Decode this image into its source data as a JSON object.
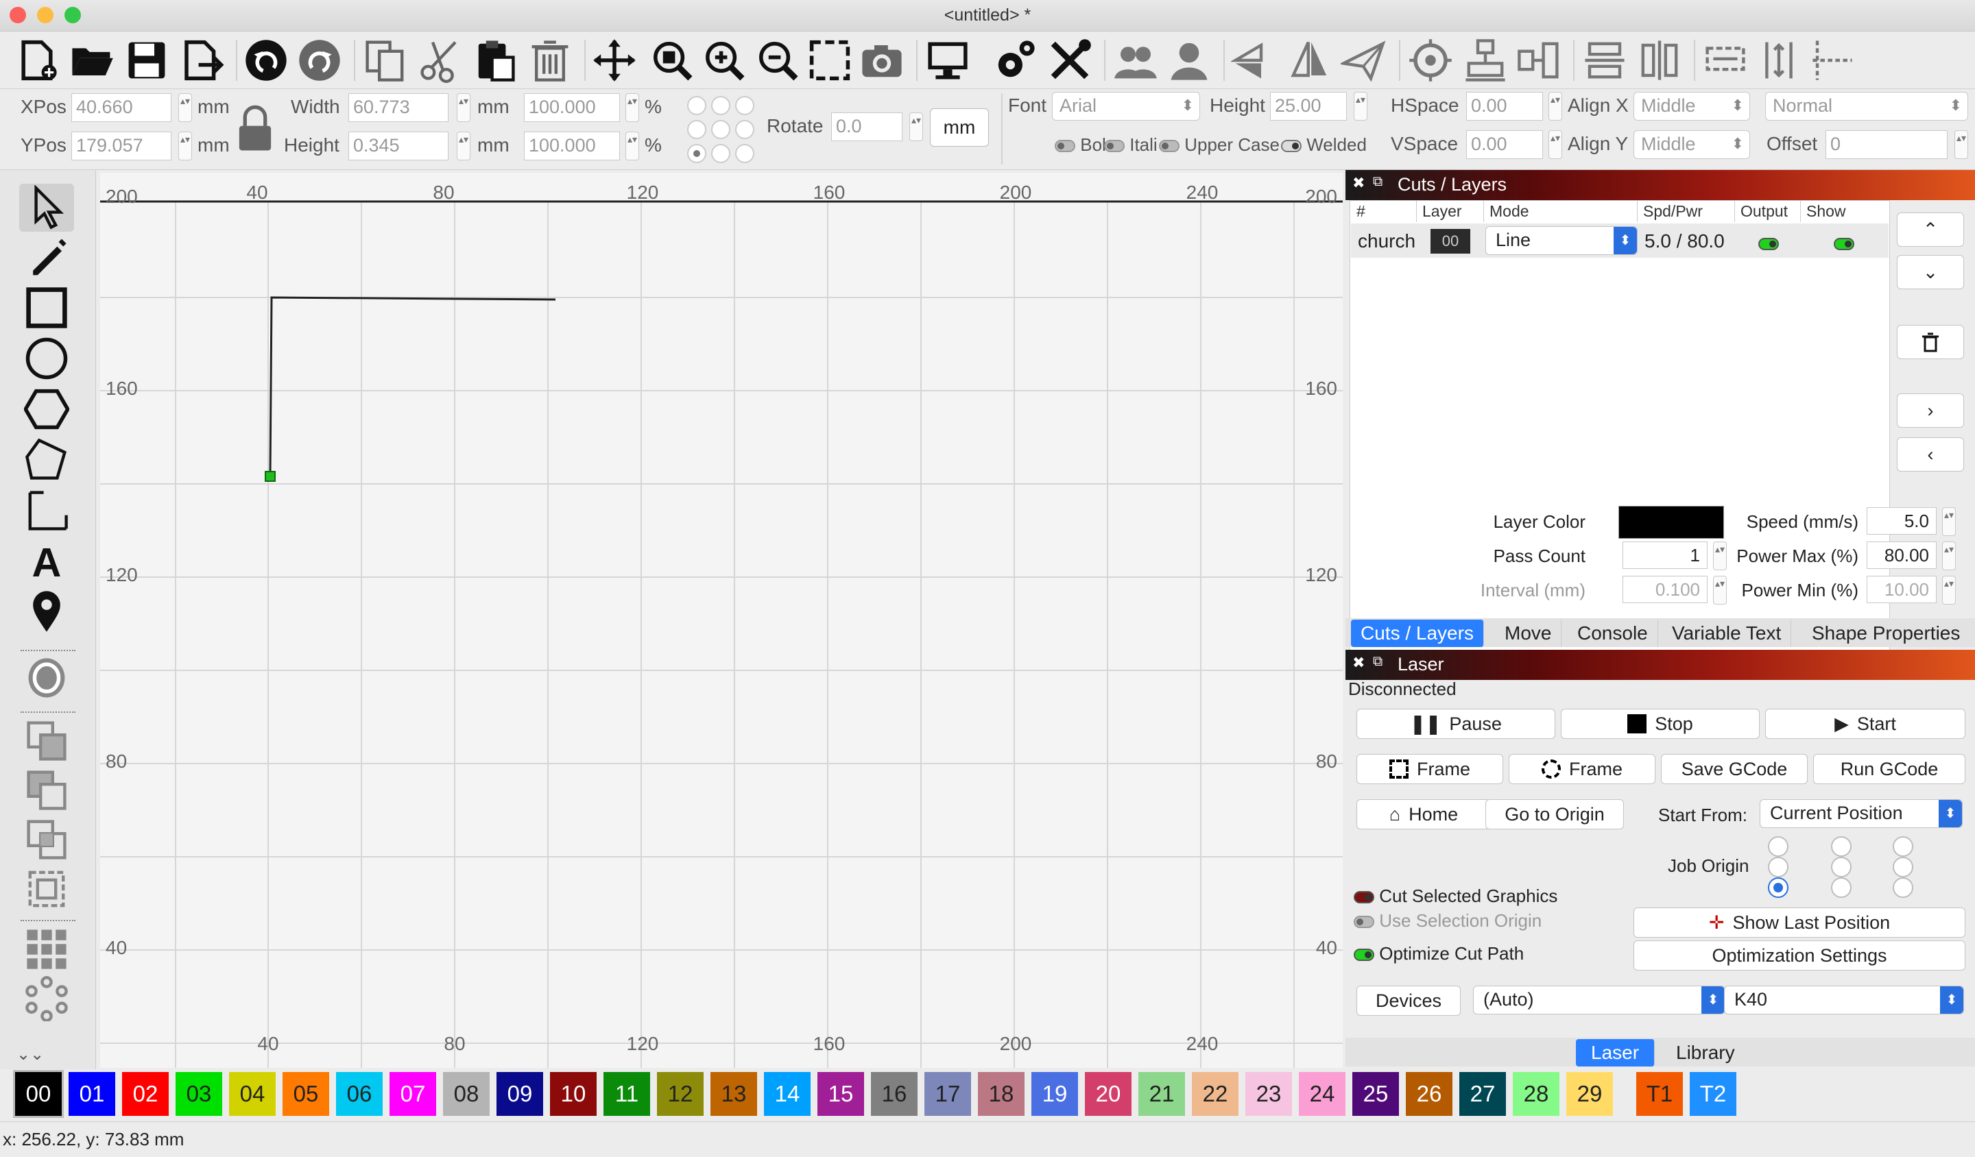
{
  "window": {
    "title": "<untitled> *"
  },
  "props": {
    "xpos_label": "XPos",
    "xpos_value": "40.660",
    "ypos_label": "YPos",
    "ypos_value": "179.057",
    "unit": "mm",
    "width_label": "Width",
    "width_value": "60.773",
    "height_label": "Height",
    "height_value": "0.345",
    "pct_w": "100.000",
    "pct_h": "100.000",
    "pct": "%",
    "rotate_label": "Rotate",
    "rotate_value": "0.0",
    "mm_button": "mm",
    "font_label": "Font",
    "font_value": "Arial",
    "fheight_label": "Height",
    "fheight_value": "25.00",
    "hspace_label": "HSpace",
    "hspace_value": "0.00",
    "vspace_label": "VSpace",
    "vspace_value": "0.00",
    "alignx_label": "Align X",
    "alignx_value": "Middle",
    "aligny_label": "Align Y",
    "aligny_value": "Middle",
    "style_value": "Normal",
    "offset_label": "Offset",
    "offset_value": "0",
    "bold": "Bol",
    "italic": "Itali",
    "upper": "Upper Case",
    "welded": "Welded"
  },
  "canvas": {
    "top_ticks": [
      "200",
      "40",
      "80",
      "120",
      "160",
      "200",
      "240",
      "200"
    ],
    "bottom_ticks": [
      "40",
      "80",
      "120",
      "160",
      "200",
      "240"
    ],
    "left_ticks": [
      "160",
      "120",
      "80",
      "40"
    ],
    "right_ticks": [
      "160",
      "120",
      "80",
      "40"
    ]
  },
  "cuts": {
    "title": "Cuts / Layers",
    "headers": [
      "#",
      "Layer",
      "Mode",
      "Spd/Pwr",
      "Output",
      "Show"
    ],
    "row": {
      "name": "church",
      "layer": "00",
      "mode": "Line",
      "spdpwr": "5.0 / 80.0"
    },
    "layer_color_label": "Layer Color",
    "layer_color": "#000000",
    "speed_label": "Speed (mm/s)",
    "speed_value": "5.0",
    "pass_label": "Pass Count",
    "pass_value": "1",
    "powermax_label": "Power Max (%)",
    "powermax_value": "80.00",
    "interval_label": "Interval (mm)",
    "interval_value": "0.100",
    "powermin_label": "Power Min (%)",
    "powermin_value": "10.00",
    "tabs": [
      "Cuts / Layers",
      "Move",
      "Console",
      "Variable Text",
      "Shape Properties"
    ]
  },
  "laser": {
    "title": "Laser",
    "status": "Disconnected",
    "pause": "Pause",
    "stop": "Stop",
    "start": "Start",
    "frame1": "Frame",
    "frame2": "Frame",
    "save_gcode": "Save GCode",
    "run_gcode": "Run GCode",
    "home": "Home",
    "go_origin": "Go to Origin",
    "start_from_label": "Start From:",
    "start_from_value": "Current Position",
    "job_origin_label": "Job Origin",
    "cut_selected": "Cut Selected Graphics",
    "use_selection": "Use Selection Origin",
    "optimize": "Optimize Cut Path",
    "show_last": "Show Last Position",
    "opt_settings": "Optimization Settings",
    "devices": "Devices",
    "device_port": "(Auto)",
    "device_model": "K40",
    "bottom_tabs": [
      "Laser",
      "Library"
    ]
  },
  "palette": [
    {
      "label": "00",
      "bg": "#000000",
      "fg": "#ffffff"
    },
    {
      "label": "01",
      "bg": "#0000ff",
      "fg": "#ffffff"
    },
    {
      "label": "02",
      "bg": "#ff0000",
      "fg": "#ffffff"
    },
    {
      "label": "03",
      "bg": "#00e000",
      "fg": "#222222"
    },
    {
      "label": "04",
      "bg": "#d2d200",
      "fg": "#222222"
    },
    {
      "label": "05",
      "bg": "#ff7a00",
      "fg": "#222222"
    },
    {
      "label": "06",
      "bg": "#00c8f0",
      "fg": "#222222"
    },
    {
      "label": "07",
      "bg": "#ff00ff",
      "fg": "#ffffff"
    },
    {
      "label": "08",
      "bg": "#b4b4b4",
      "fg": "#222222"
    },
    {
      "label": "09",
      "bg": "#0a0a8c",
      "fg": "#ffffff"
    },
    {
      "label": "10",
      "bg": "#8c0a0a",
      "fg": "#ffffff"
    },
    {
      "label": "11",
      "bg": "#0a8c0a",
      "fg": "#ffffff"
    },
    {
      "label": "12",
      "bg": "#8c8c0a",
      "fg": "#222222"
    },
    {
      "label": "13",
      "bg": "#be6400",
      "fg": "#222222"
    },
    {
      "label": "14",
      "bg": "#00a0ff",
      "fg": "#ffffff"
    },
    {
      "label": "15",
      "bg": "#a01e96",
      "fg": "#ffffff"
    },
    {
      "label": "16",
      "bg": "#808080",
      "fg": "#222222"
    },
    {
      "label": "17",
      "bg": "#7d87b9",
      "fg": "#222222"
    },
    {
      "label": "18",
      "bg": "#bb7784",
      "fg": "#222222"
    },
    {
      "label": "19",
      "bg": "#4a6fe3",
      "fg": "#ffffff"
    },
    {
      "label": "20",
      "bg": "#d33f6a",
      "fg": "#ffffff"
    },
    {
      "label": "21",
      "bg": "#8cd78c",
      "fg": "#222222"
    },
    {
      "label": "22",
      "bg": "#f0b98d",
      "fg": "#222222"
    },
    {
      "label": "23",
      "bg": "#f6c4e1",
      "fg": "#222222"
    },
    {
      "label": "24",
      "bg": "#fa9ed4",
      "fg": "#222222"
    },
    {
      "label": "25",
      "bg": "#500a78",
      "fg": "#ffffff"
    },
    {
      "label": "26",
      "bg": "#b45a00",
      "fg": "#ffffff"
    },
    {
      "label": "27",
      "bg": "#004754",
      "fg": "#ffffff"
    },
    {
      "label": "28",
      "bg": "#86fa88",
      "fg": "#222222"
    },
    {
      "label": "29",
      "bg": "#ffdb66",
      "fg": "#222222"
    },
    {
      "label": "T1",
      "bg": "#f35a00",
      "fg": "#222222"
    },
    {
      "label": "T2",
      "bg": "#1e90ff",
      "fg": "#ffffff"
    }
  ],
  "status": {
    "coords": "x: 256.22, y: 73.83 mm"
  }
}
